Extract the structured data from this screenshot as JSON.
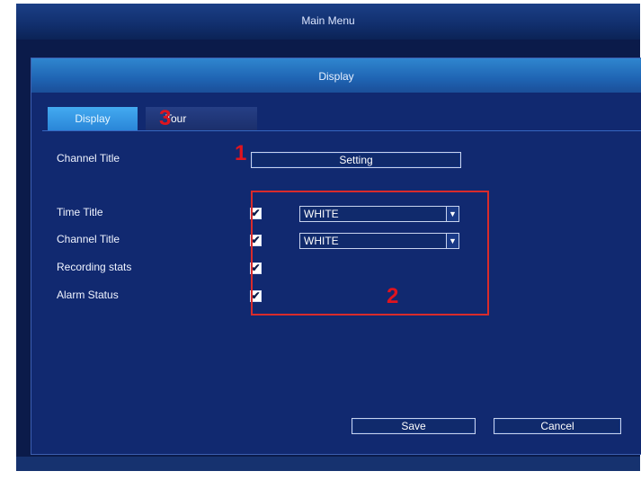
{
  "main_menu": {
    "title": "Main Menu"
  },
  "dialog": {
    "title": "Display"
  },
  "tabs": [
    {
      "label": "Display"
    },
    {
      "label": "Tour"
    }
  ],
  "channel_title_row": {
    "label": "Channel Title",
    "button_label": "Setting"
  },
  "options": [
    {
      "label": "Time Title",
      "checked": true,
      "mark": "✔",
      "select_value": "WHITE"
    },
    {
      "label": "Channel Title",
      "checked": true,
      "mark": "✔",
      "select_value": "WHITE"
    },
    {
      "label": "Recording stats",
      "checked": true,
      "mark": "✔"
    },
    {
      "label": "Alarm Status",
      "checked": true,
      "mark": "✔"
    }
  ],
  "buttons": {
    "save": "Save",
    "cancel": "Cancel"
  },
  "annotations": {
    "one": "1",
    "two": "2",
    "three": "3"
  },
  "colors": {
    "background": "#0b1b4a",
    "dialog_header": "#2f86cf",
    "active_tab": "#44aaf0",
    "annotation": "#e0141e"
  },
  "icons": {
    "dropdown": "chevron-down-icon",
    "check": "check-icon"
  }
}
